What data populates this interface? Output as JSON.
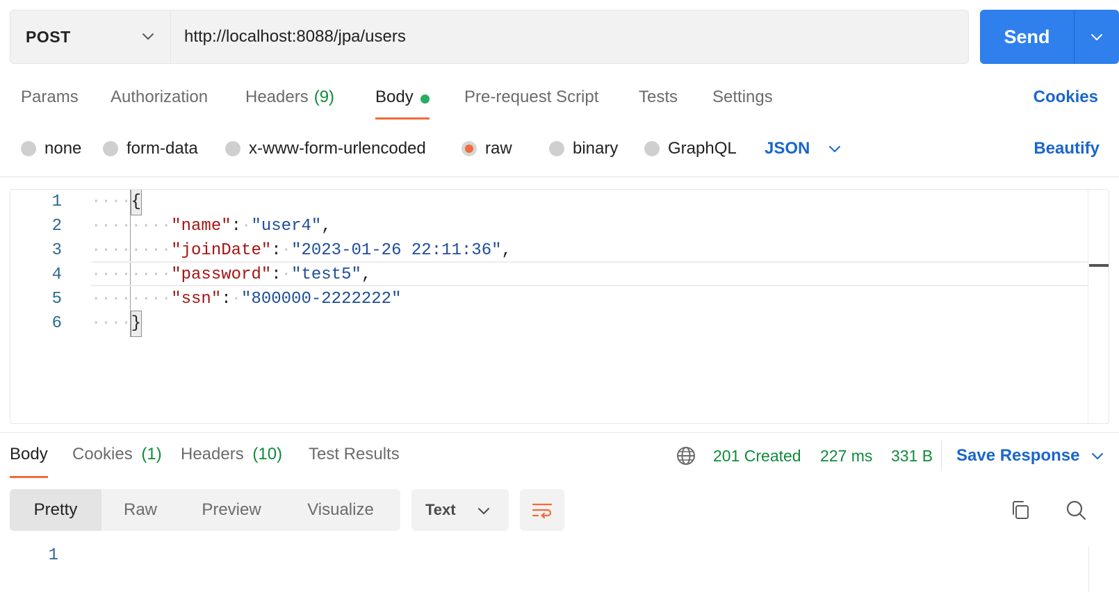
{
  "request": {
    "method": "POST",
    "url": "http://localhost:8088/jpa/users",
    "send_label": "Send"
  },
  "request_tabs": {
    "params": "Params",
    "authorization": "Authorization",
    "headers": "Headers",
    "headers_count": "(9)",
    "body": "Body",
    "pre_request": "Pre-request Script",
    "tests": "Tests",
    "settings": "Settings",
    "cookies": "Cookies",
    "active": "Body"
  },
  "body_types": {
    "none": "none",
    "form_data": "form-data",
    "urlencoded": "x-www-form-urlencoded",
    "raw": "raw",
    "binary": "binary",
    "graphql": "GraphQL",
    "selected": "raw",
    "format": "JSON",
    "beautify": "Beautify"
  },
  "editor": {
    "line_numbers": [
      "1",
      "2",
      "3",
      "4",
      "5",
      "6"
    ],
    "open_brace": "{",
    "close_brace": "}",
    "fields": [
      {
        "key": "\"name\"",
        "value": "\"user4\"",
        "trail": ","
      },
      {
        "key": "\"joinDate\"",
        "value": "\"2023-01-26 22:11:36\"",
        "trail": ","
      },
      {
        "key": "\"password\"",
        "value": "\"test5\"",
        "trail": ","
      },
      {
        "key": "\"ssn\"",
        "value": "\"800000-2222222\"",
        "trail": ""
      }
    ],
    "current_line": 4
  },
  "response_tabs": {
    "body": "Body",
    "cookies": "Cookies",
    "cookies_count": "(1)",
    "headers": "Headers",
    "headers_count": "(10)",
    "test_results": "Test Results",
    "active": "Body"
  },
  "response_meta": {
    "status": "201 Created",
    "time": "227 ms",
    "size": "331 B",
    "save_response": "Save Response",
    "status_color": "#0f8a3c"
  },
  "response_view": {
    "modes": [
      "Pretty",
      "Raw",
      "Preview",
      "Visualize"
    ],
    "active_mode": "Pretty",
    "format": "Text",
    "line_numbers": [
      "1"
    ]
  },
  "icons": {
    "method_dropdown": "chevron-down-icon",
    "send_dropdown": "chevron-down-icon",
    "network": "globe-icon",
    "wrap": "wrap-lines-icon",
    "copy": "copy-icon",
    "search": "search-icon"
  },
  "colors": {
    "accent": "#f26b3a",
    "brand_blue": "#2f80ed",
    "link_blue": "#1a66cc",
    "success_green": "#0f8a3c"
  }
}
